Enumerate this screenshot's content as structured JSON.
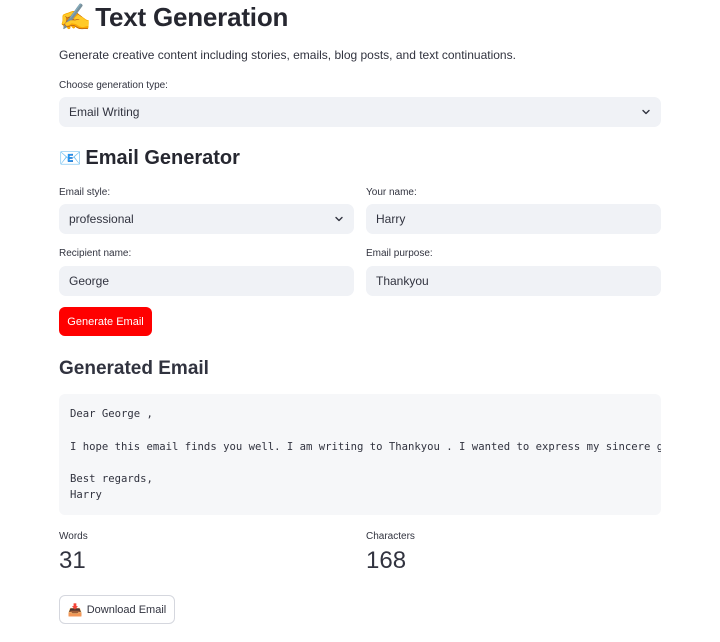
{
  "header": {
    "icon": "writing-hand-icon",
    "emoji": "✍️",
    "title": "Text Generation",
    "description": "Generate creative content including stories, emails, blog posts, and text continuations."
  },
  "generation_type": {
    "label": "Choose generation type:",
    "value": "Email Writing"
  },
  "email_generator": {
    "icon": "email-icon",
    "emoji": "📧",
    "title": "Email Generator",
    "style": {
      "label": "Email style:",
      "value": "professional"
    },
    "your_name": {
      "label": "Your name:",
      "value": "Harry"
    },
    "recipient": {
      "label": "Recipient name:",
      "value": "George"
    },
    "purpose": {
      "label": "Email purpose:",
      "value": "Thankyou"
    },
    "generate_button": "Generate Email"
  },
  "generated": {
    "title": "Generated Email",
    "lines": [
      "Dear George ,",
      "",
      "I hope this email finds you well. I am writing to Thankyou . I wanted to express my sincere gratitude",
      "",
      "Best regards,",
      "Harry"
    ]
  },
  "metrics": {
    "words_label": "Words",
    "words_value": "31",
    "chars_label": "Characters",
    "chars_value": "168"
  },
  "download": {
    "icon": "inbox-tray-icon",
    "emoji": "📥",
    "label": "Download Email"
  },
  "colors": {
    "primary_button": "#ff0000",
    "input_bg": "#f0f2f6",
    "code_bg": "#f6f7f9",
    "text": "#31333f"
  }
}
